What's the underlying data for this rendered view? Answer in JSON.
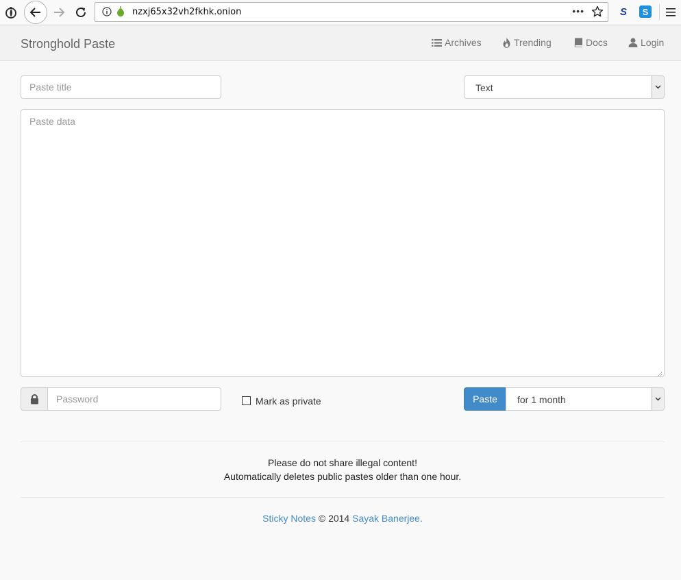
{
  "browser": {
    "url": "nzxj65x32vh2fkhk.onion",
    "ext1_label": "S",
    "ext2_label": "S",
    "dots": "•••"
  },
  "navbar": {
    "brand": "Stronghold Paste",
    "links": {
      "archives": "Archives",
      "trending": "Trending",
      "docs": "Docs",
      "login": "Login"
    }
  },
  "form": {
    "title_placeholder": "Paste title",
    "language_selected": "Text",
    "data_placeholder": "Paste data",
    "password_placeholder": "Password",
    "private_label": "Mark as private",
    "paste_button": "Paste",
    "expire_selected": "for 1 month"
  },
  "notices": {
    "line1": "Please do not share illegal content!",
    "line2": "Automatically deletes public pastes older than one hour."
  },
  "footer": {
    "project": "Sticky Notes",
    "copyright": "© 2014",
    "author": "Sayak Banerjee."
  },
  "colors": {
    "primary": "#428bca",
    "navbar_bg": "#f2f2f2",
    "page_bg": "#f9f9f9"
  }
}
